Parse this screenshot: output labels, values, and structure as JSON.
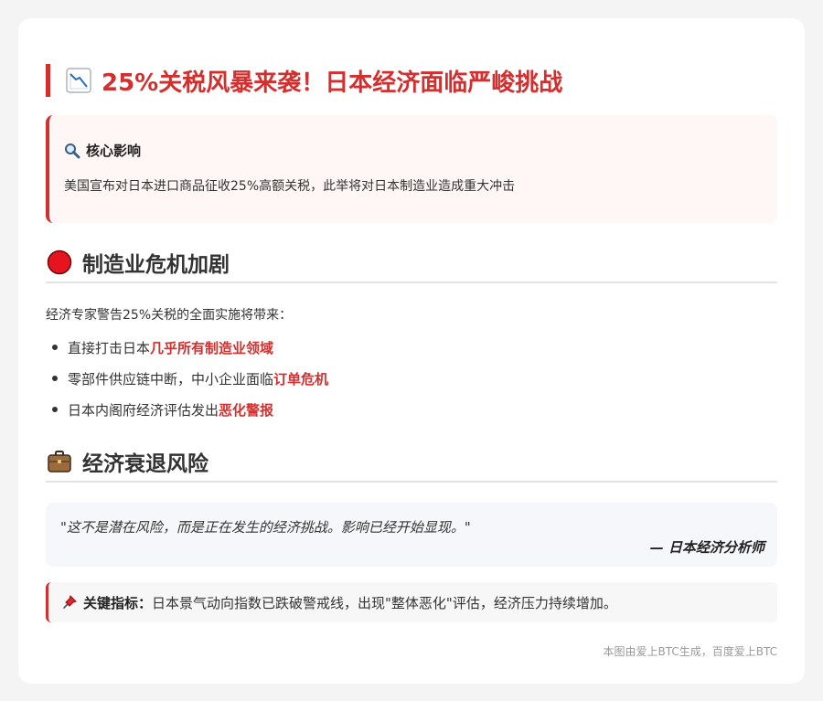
{
  "title": {
    "icon": "chart-decreasing-icon",
    "text": "25%关税风暴来袭！日本经济面临严峻挑战"
  },
  "core_impact": {
    "icon": "magnifier-icon",
    "heading": "核心影响",
    "text": "美国宣布对日本进口商品征收25%高额关税，此举将对日本制造业造成重大冲击"
  },
  "manufacturing": {
    "icon": "red-circle-icon",
    "heading": "制造业危机加剧",
    "intro": "经济专家警告25%关税的全面实施将带来：",
    "bullets": [
      {
        "text": "直接打击日本",
        "highlight": "几乎所有制造业领域"
      },
      {
        "text": "零部件供应链中断，中小企业面临",
        "highlight": "订单危机"
      },
      {
        "text": "日本内阁府经济评估发出",
        "highlight": "恶化警报"
      }
    ]
  },
  "recession": {
    "icon": "briefcase-icon",
    "heading": "经济衰退风险",
    "quote": "\"这不是潜在风险，而是正在发生的经济挑战。影响已经开始显现。\"",
    "author": "— 日本经济分析师"
  },
  "indicator": {
    "icon": "pushpin-icon",
    "label": "关键指标：",
    "text": "日本景气动向指数已跌破警戒线，出现\"整体恶化\"评估，经济压力持续增加。"
  },
  "footer": "本图由爱上BTC生成，百度爱上BTC",
  "colors": {
    "accent": "#d32f2f",
    "core_bg": "#fff6f6",
    "quote_bg": "#f5f7fa",
    "page_bg": "#f4f4f4"
  }
}
